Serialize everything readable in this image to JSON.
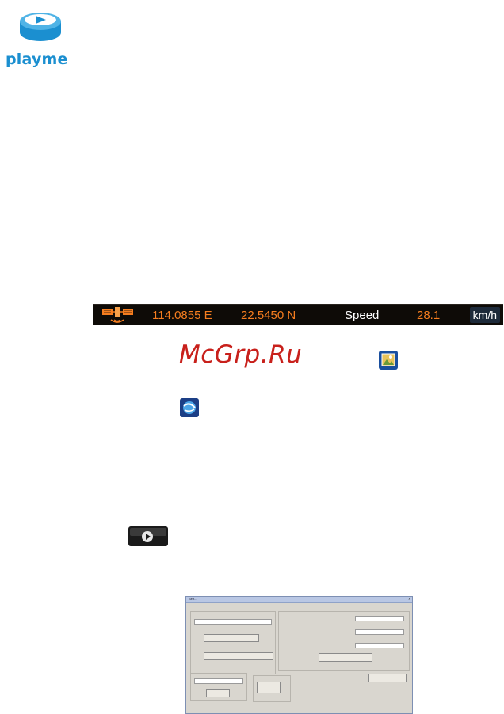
{
  "brand": {
    "name": "playme",
    "color": "#1b8fd0"
  },
  "gps_bar": {
    "longitude": "114.0855 E",
    "latitude": "22.5450 N",
    "speed_label": "Speed",
    "speed_value": "28.1",
    "speed_unit": "km/h",
    "accent_color": "#f57d1f"
  },
  "watermark": {
    "text": "McGrp.Ru",
    "color": "#c8201b"
  },
  "icons": {
    "satellite": "satellite-icon",
    "photo": "photo-icon",
    "globe": "globe-icon",
    "play": "play-button-icon"
  },
  "dialog": {
    "title": "Sett...",
    "close": "x"
  }
}
